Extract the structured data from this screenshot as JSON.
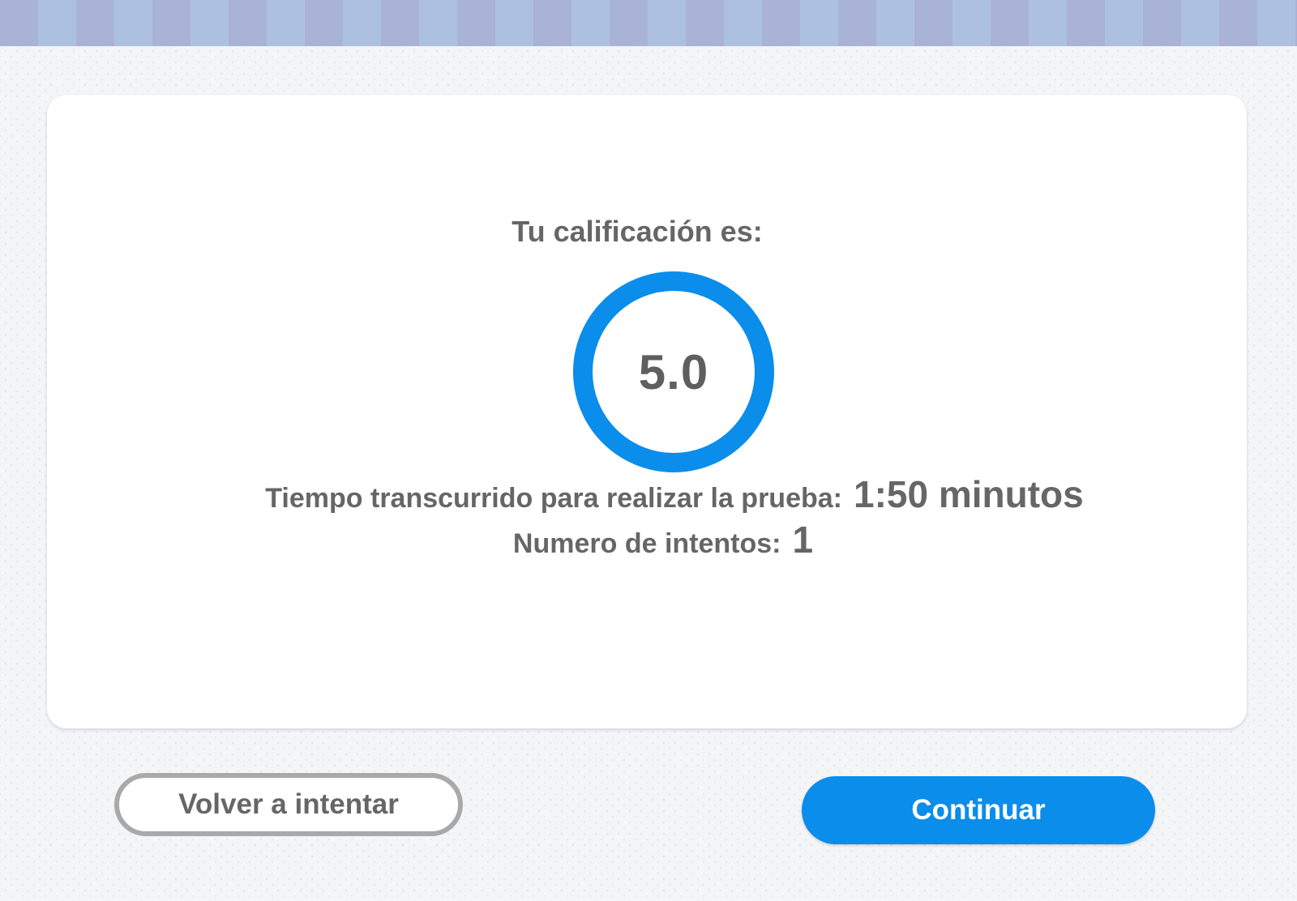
{
  "result": {
    "grade_label": "Tu calificación es:",
    "score": "5.0",
    "time_label": "Tiempo transcurrido para realizar la prueba:",
    "time_value": "1:50 minutos",
    "attempts_label": "Numero de intentos:",
    "attempts_value": "1"
  },
  "actions": {
    "retry_label": "Volver a intentar",
    "continue_label": "Continuar"
  },
  "colors": {
    "accent": "#0a8deb",
    "text": "#666666",
    "stripe_a": "#a9b3d6",
    "stripe_b": "#aec0e0"
  }
}
